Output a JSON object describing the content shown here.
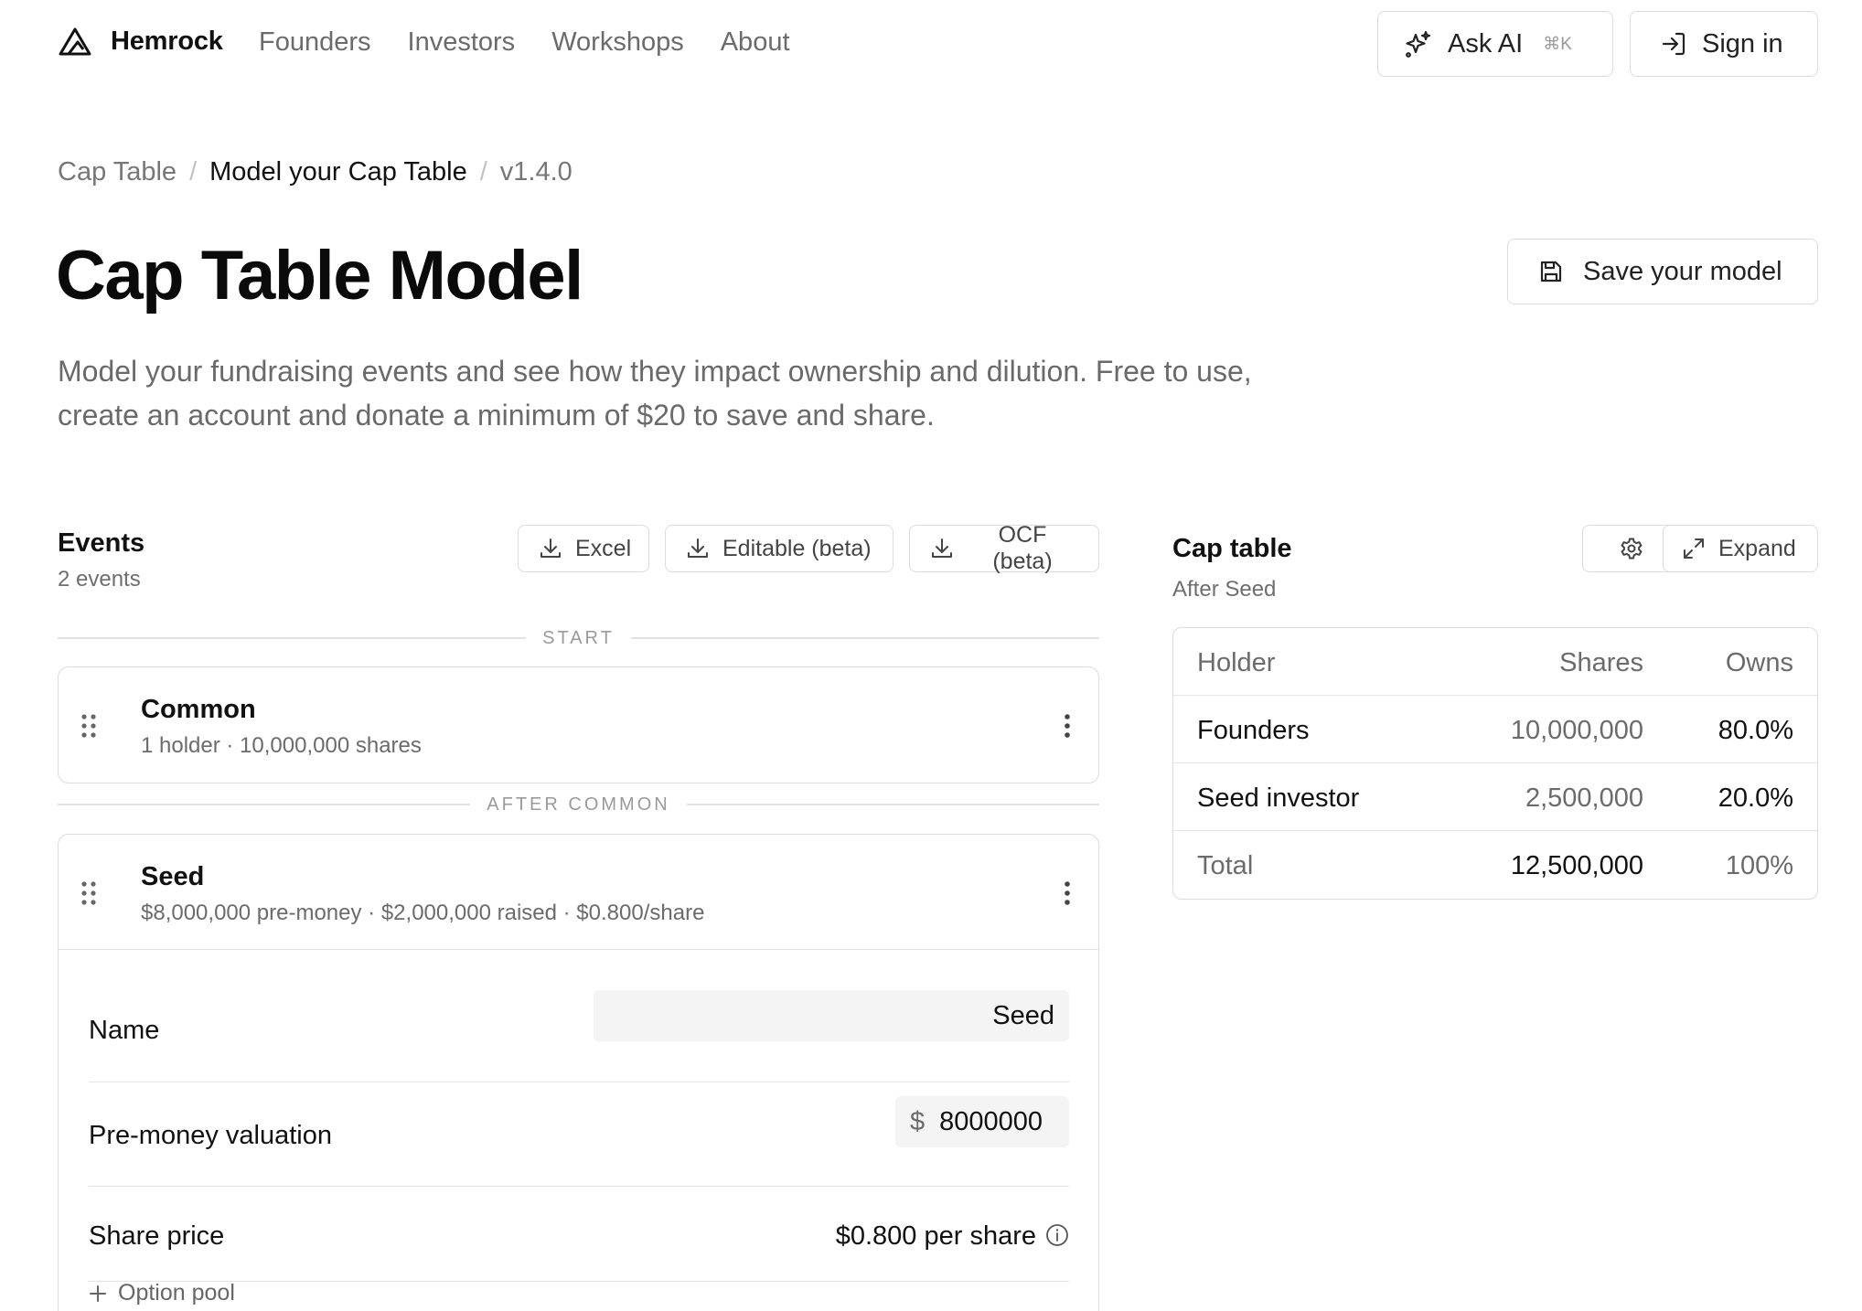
{
  "brand": {
    "name": "Hemrock"
  },
  "nav": {
    "links": [
      "Founders",
      "Investors",
      "Workshops",
      "About"
    ],
    "ask_ai": "Ask AI",
    "ask_ai_shortcut": "⌘K",
    "sign_in": "Sign in"
  },
  "breadcrumb": {
    "items": [
      "Cap Table",
      "Model your Cap Table",
      "v1.4.0"
    ],
    "separator": "/"
  },
  "page": {
    "title": "Cap Table Model",
    "save_label": "Save your model",
    "description": "Model your fundraising events and see how they impact ownership and dilution. Free to use, create an account and donate a minimum of $20 to save and share."
  },
  "events": {
    "title": "Events",
    "count_label": "2 events",
    "exports": [
      "Excel",
      "Editable (beta)",
      "OCF (beta)"
    ],
    "dividers": {
      "start": "START",
      "after_common": "AFTER COMMON"
    },
    "common": {
      "name": "Common",
      "meta": "1 holder · 10,000,000 shares"
    },
    "seed": {
      "name": "Seed",
      "meta": "$8,000,000 pre-money · $2,000,000 raised · $0.800/share",
      "fields": {
        "name_label": "Name",
        "name_value": "Seed",
        "premoney_label": "Pre-money valuation",
        "currency_symbol": "$",
        "premoney_value": "8000000",
        "share_price_label": "Share price",
        "share_price_value": "$0.800 per share",
        "option_pool_label": "Option pool"
      }
    }
  },
  "cap_table": {
    "title": "Cap table",
    "subtitle": "After Seed",
    "expand_label": "Expand",
    "columns": {
      "holder": "Holder",
      "shares": "Shares",
      "owns": "Owns"
    },
    "rows": [
      {
        "holder": "Founders",
        "shares": "10,000,000",
        "owns": "80.0%"
      },
      {
        "holder": "Seed investor",
        "shares": "2,500,000",
        "owns": "20.0%"
      }
    ],
    "total": {
      "holder": "Total",
      "shares": "12,500,000",
      "owns": "100%"
    }
  }
}
